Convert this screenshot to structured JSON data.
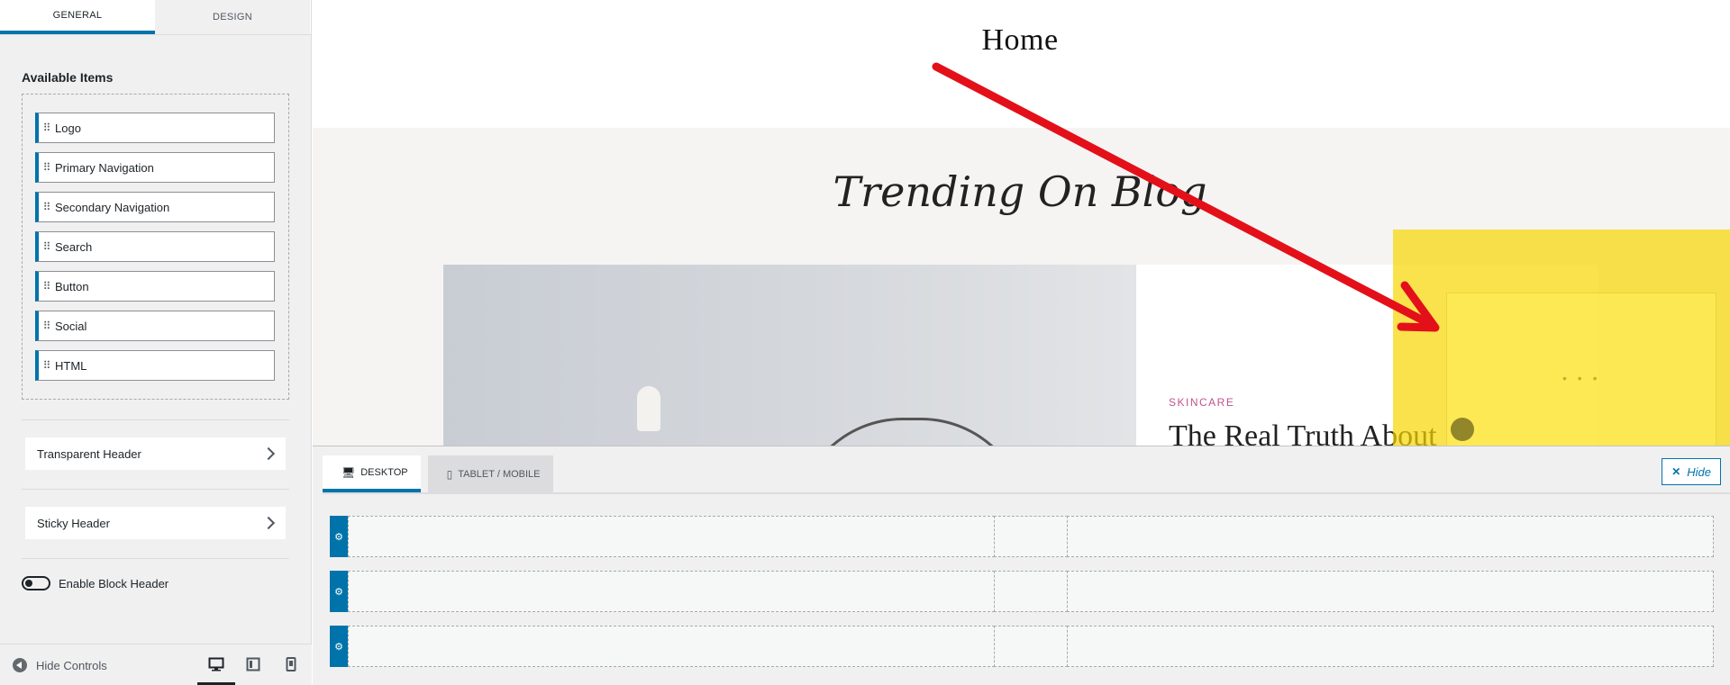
{
  "sidebar": {
    "tabs": {
      "general": "GENERAL",
      "design": "DESIGN"
    },
    "available_title": "Available Items",
    "items": [
      "Logo",
      "Primary Navigation",
      "Secondary Navigation",
      "Search",
      "Button",
      "Social",
      "HTML"
    ],
    "transparent_header": "Transparent Header",
    "sticky_header": "Sticky Header",
    "enable_block_header": "Enable Block Header",
    "hide_controls": "Hide Controls",
    "devices": [
      "desktop-icon",
      "tablet-icon",
      "mobile-icon"
    ]
  },
  "preview": {
    "page_title": "Home",
    "section_title": "Trending On Blog",
    "post_category": "SKINCARE",
    "post_title": "The Real Truth About",
    "more_dots": "• • •"
  },
  "builder": {
    "tab_desktop": "DESKTOP",
    "tab_tablet": "TABLET / MOBILE",
    "hide_label": "Hide",
    "rows": [
      "top-row",
      "main-row",
      "bottom-row"
    ]
  },
  "colors": {
    "accent": "#0073aa",
    "highlight": "#f6d600",
    "arrow": "#e3101a",
    "category": "#c2528c"
  }
}
